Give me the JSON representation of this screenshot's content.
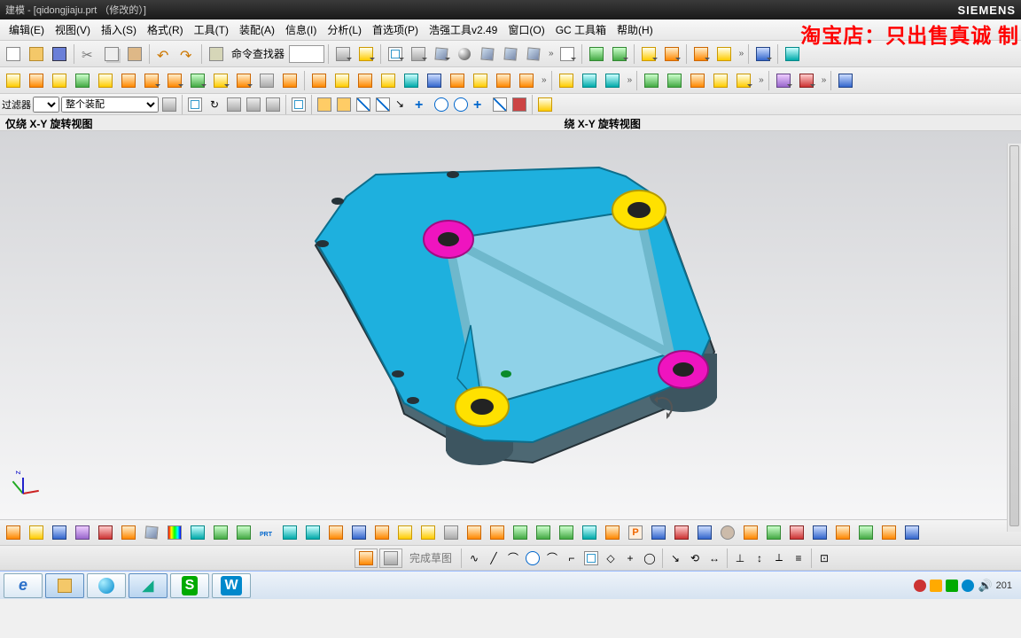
{
  "title": "建模 - [qidongjiaju.prt （修改的）]",
  "brand": "SIEMENS",
  "watermark": "淘宝店：只出售真诚 制",
  "menu": [
    "编辑(E)",
    "视图(V)",
    "插入(S)",
    "格式(R)",
    "工具(T)",
    "装配(A)",
    "信息(I)",
    "分析(L)",
    "首选项(P)",
    "浩强工具v2.49",
    "窗口(O)",
    "GC 工具箱",
    "帮助(H)"
  ],
  "finder_label": "命令查找器",
  "filter_label": "过滤器",
  "assembly_option": "整个装配",
  "view_left_label": "仅绕 X-Y 旋转视图",
  "view_right_label": "绕 X-Y 旋转视图",
  "sketch_finish": "完成草图",
  "tray_year": "201",
  "colors": {
    "body": "#1eb0de",
    "boss_yellow": "#ffe100",
    "boss_magenta": "#ef14bf",
    "hole_inner": "#232323",
    "side": "#4d6873"
  }
}
